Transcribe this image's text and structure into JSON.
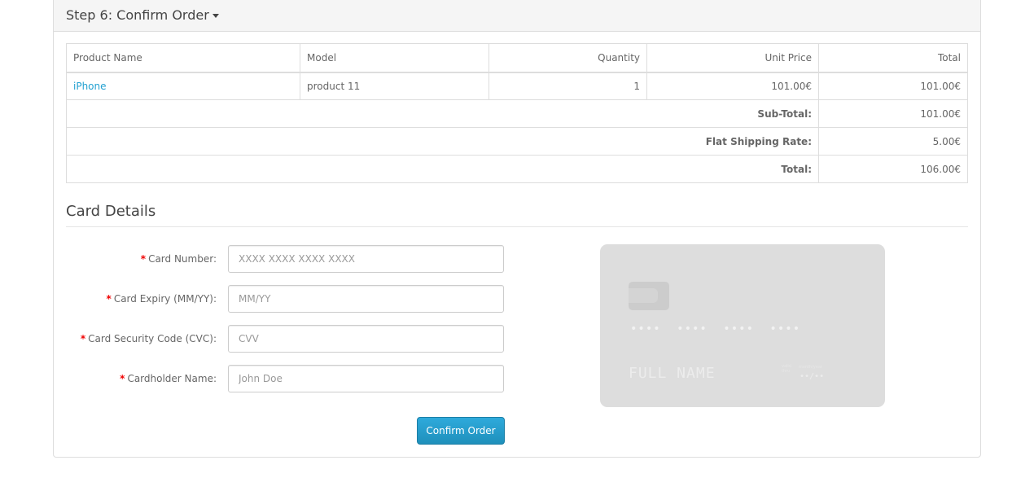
{
  "panel": {
    "title": "Step 6: Confirm Order"
  },
  "table": {
    "headers": [
      "Product Name",
      "Model",
      "Quantity",
      "Unit Price",
      "Total"
    ],
    "rows": [
      {
        "product": "iPhone",
        "model": "product 11",
        "quantity": "1",
        "unit_price": "101.00€",
        "total": "101.00€"
      }
    ],
    "totals": [
      {
        "label": "Sub-Total:",
        "value": "101.00€"
      },
      {
        "label": "Flat Shipping Rate:",
        "value": "5.00€"
      },
      {
        "label": "Total:",
        "value": "106.00€"
      }
    ]
  },
  "card_details": {
    "legend": "Card Details",
    "required_marker": "*",
    "fields": [
      {
        "label": "Card Number:",
        "placeholder": "XXXX XXXX XXXX XXXX"
      },
      {
        "label": "Card Expiry (MM/YY):",
        "placeholder": "MM/YY"
      },
      {
        "label": "Card Security Code (CVC):",
        "placeholder": "CVV"
      },
      {
        "label": "Cardholder Name:",
        "placeholder": "John Doe"
      }
    ],
    "confirm_label": "Confirm Order"
  },
  "card_preview": {
    "number": "•••• •••• •••• ••••",
    "name": "FULL NAME",
    "valid_text": "valid thru",
    "month_year": "month/year",
    "expiry": "••/••"
  },
  "colors": {
    "link": "#23a1d1",
    "required": "#f00000",
    "button": "#229ac8",
    "card_bg": "#dddddd"
  }
}
